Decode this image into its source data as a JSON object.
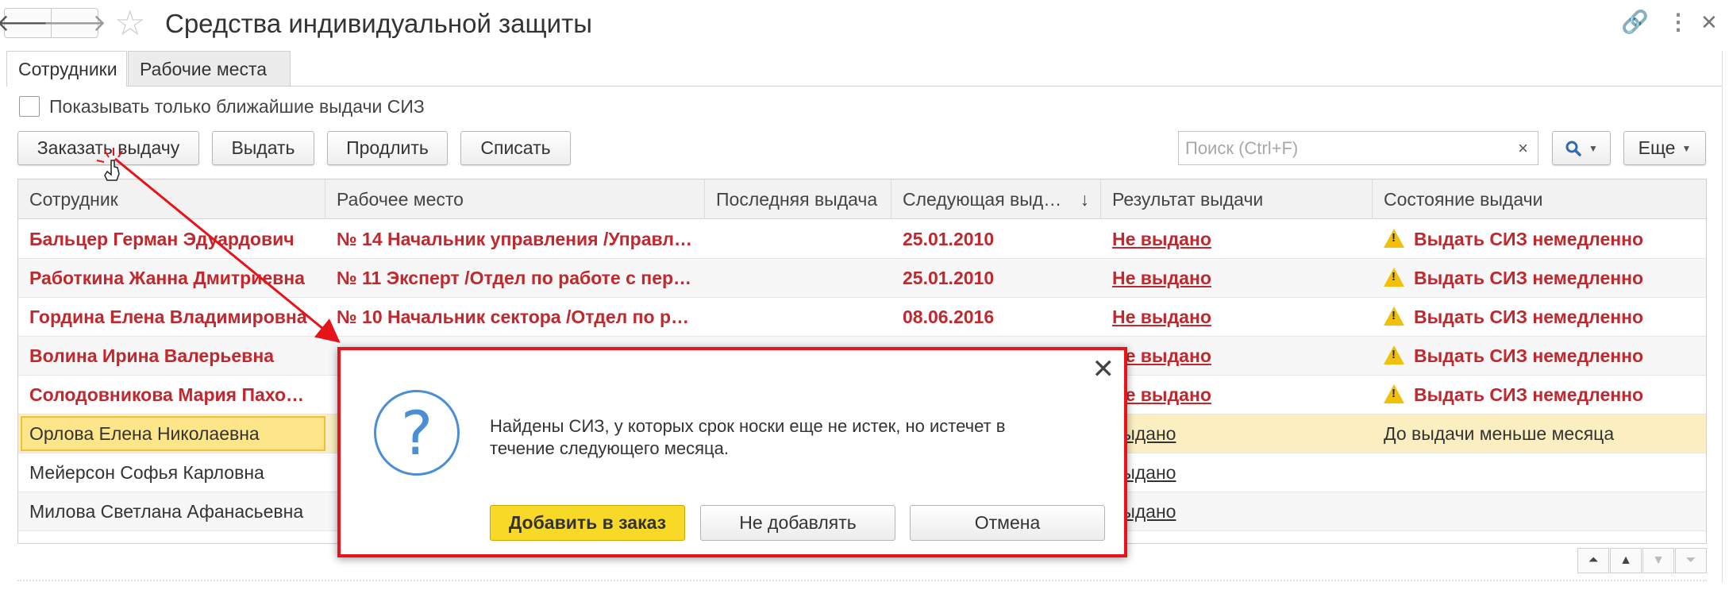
{
  "window": {
    "title": "Средства индивидуальной защиты"
  },
  "tabs": [
    {
      "label": "Сотрудники",
      "active": true
    },
    {
      "label": "Рабочие места",
      "active": false
    }
  ],
  "filter": {
    "checkbox_label": "Показывать только ближайшие выдачи СИЗ",
    "checked": false
  },
  "toolbar": {
    "order_label": "Заказать выдачу",
    "issue_label": "Выдать",
    "extend_label": "Продлить",
    "writeoff_label": "Списать",
    "search_placeholder": "Поиск (Ctrl+F)",
    "clear_label": "×",
    "more_label": "Еще"
  },
  "table": {
    "columns": [
      "Сотрудник",
      "Рабочее место",
      "Последняя выдача",
      "Следующая выд…",
      "Результат выдачи",
      "Состояние выдачи"
    ],
    "sort_indicator": "↓",
    "rows": [
      {
        "employee": "Бальцер Герман Эдуардович",
        "workplace": "№ 14 Начальник управления /Управл…",
        "last": "",
        "next": "25.01.2010",
        "result": "Не выдано",
        "state": "Выдать СИЗ немедленно",
        "style": "urgent"
      },
      {
        "employee": "Работкина Жанна Дмитриевна",
        "workplace": "№ 11 Эксперт /Отдел по работе с пер…",
        "last": "",
        "next": "25.01.2010",
        "result": "Не выдано",
        "state": "Выдать СИЗ немедленно",
        "style": "urgent"
      },
      {
        "employee": "Гордина Елена Владимировна",
        "workplace": "№ 10 Начальник сектора /Отдел по р…",
        "last": "",
        "next": "08.06.2016",
        "result": "Не выдано",
        "state": "Выдать СИЗ немедленно",
        "style": "urgent"
      },
      {
        "employee": "Волина Ирина Валерьевна",
        "workplace": "",
        "last": "",
        "next": "",
        "result": "Не выдано",
        "state": "Выдать СИЗ немедленно",
        "style": "urgent"
      },
      {
        "employee": "Солодовникова Мария Пахо…",
        "workplace": "",
        "last": "",
        "next": "",
        "result": "Не выдано",
        "state": "Выдать СИЗ немедленно",
        "style": "urgent"
      },
      {
        "employee": "Орлова Елена Николаевна",
        "workplace": "",
        "last": "",
        "next": "",
        "result": "выдано",
        "state": "До выдачи меньше месяца",
        "style": "selected"
      },
      {
        "employee": "Мейерсон Софья Карловна",
        "workplace": "",
        "last": "",
        "next": "",
        "result": "выдано",
        "state": "",
        "style": "normal"
      },
      {
        "employee": "Милова Светлана Афанасьевна",
        "workplace": "",
        "last": "",
        "next": "",
        "result": "выдано",
        "state": "",
        "style": "normal"
      }
    ]
  },
  "dialog": {
    "message": "Найдены СИЗ, у которых срок носки еще не истек, но истечет в течение следующего месяца.",
    "add_label": "Добавить в заказ",
    "skip_label": "Не добавлять",
    "cancel_label": "Отмена"
  },
  "colors": {
    "urgent_text": "#c1272d",
    "highlight": "#e8131a",
    "selected_row": "#fbefc2",
    "primary_button": "#f9d928"
  },
  "icons": {
    "back": "arrow-left-icon",
    "forward": "arrow-right-icon",
    "favorite": "star-icon",
    "link": "link-icon",
    "more": "kebab-icon",
    "close": "close-icon",
    "search": "search-icon",
    "warning": "warning-icon",
    "question": "question-icon"
  }
}
